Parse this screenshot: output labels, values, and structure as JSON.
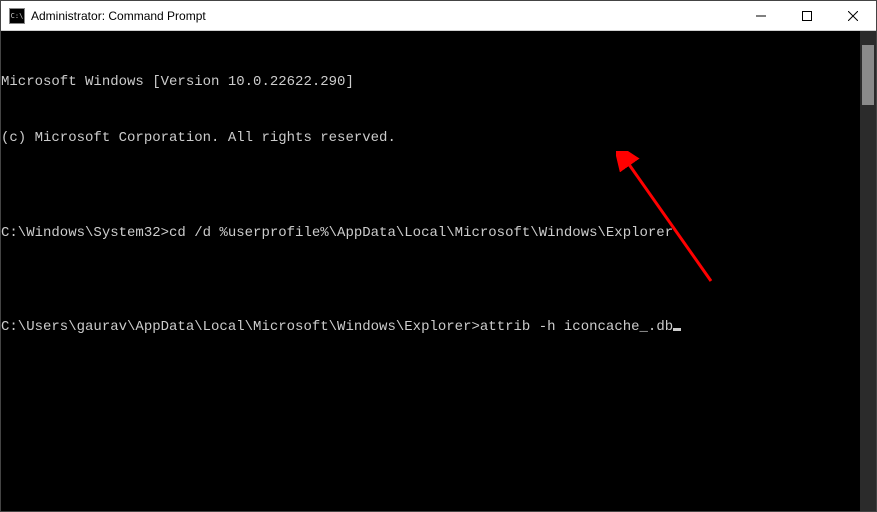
{
  "window": {
    "title": "Administrator: Command Prompt",
    "icon_label": "cmd-icon",
    "icon_text": "C:\\"
  },
  "terminal": {
    "lines": [
      "Microsoft Windows [Version 10.0.22622.290]",
      "(c) Microsoft Corporation. All rights reserved.",
      "",
      "C:\\Windows\\System32>cd /d %userprofile%\\AppData\\Local\\Microsoft\\Windows\\Explorer",
      ""
    ],
    "current_prompt": "C:\\Users\\gaurav\\AppData\\Local\\Microsoft\\Windows\\Explorer>",
    "current_command": "attrib -h iconcache_.db"
  },
  "annotation": {
    "type": "arrow",
    "color": "#ff0000"
  }
}
